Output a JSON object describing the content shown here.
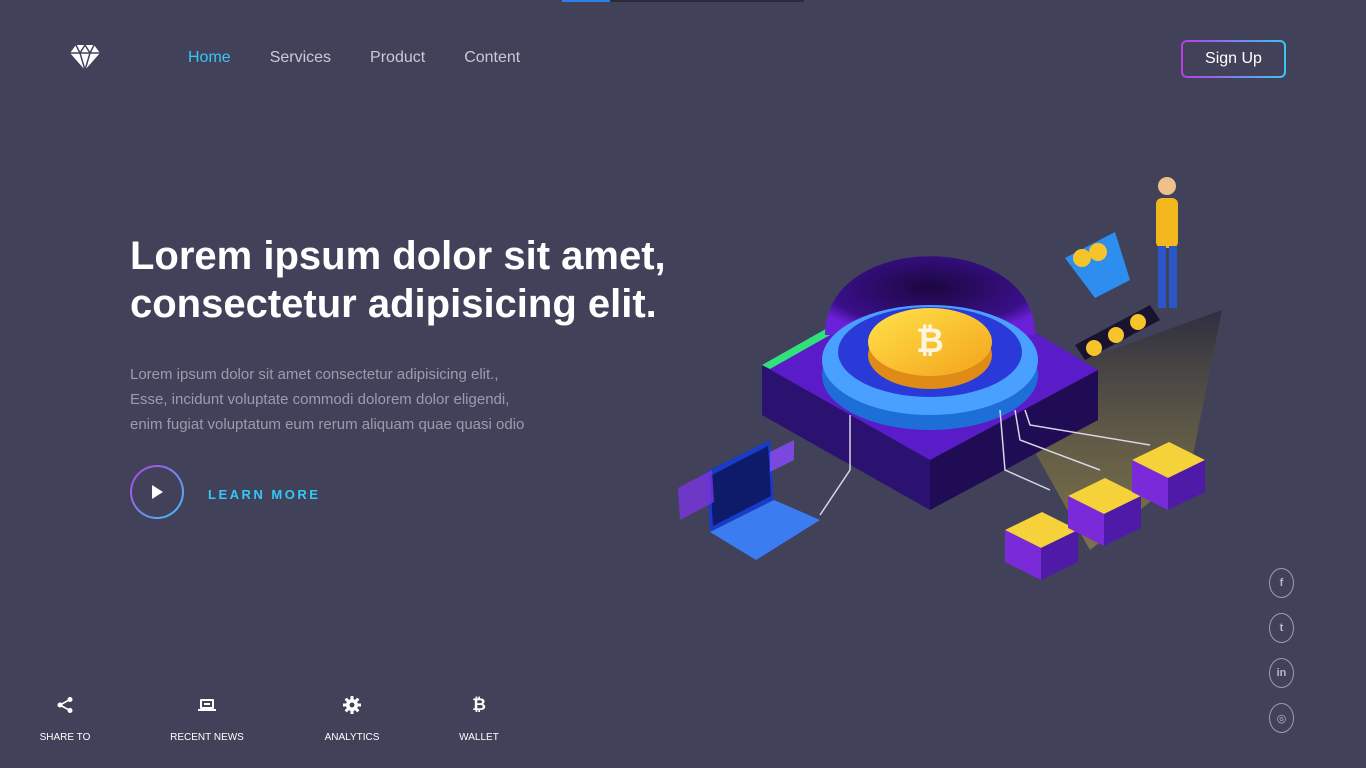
{
  "top_progress": {
    "fraction": 0.2
  },
  "brand": {
    "icon": "diamond-icon"
  },
  "nav": {
    "items": [
      {
        "label": "Home",
        "active": true
      },
      {
        "label": "Services",
        "active": false
      },
      {
        "label": "Product",
        "active": false
      },
      {
        "label": "Content",
        "active": false
      }
    ],
    "signup_label": "Sign Up"
  },
  "hero": {
    "title_line1": "Lorem ipsum dolor sit amet,",
    "title_line2": "consectetur adipisicing elit.",
    "desc_line1": "Lorem ipsum dolor sit amet consectetur adipisicing elit.,",
    "desc_line2": "Esse, incidunt voluptate commodi dolorem dolor eligendi,",
    "desc_line3": "enim fugiat voluptatum eum rerum aliquam quae quasi odio",
    "cta_label": "LEARN MORE"
  },
  "social": {
    "items": [
      {
        "icon": "facebook-icon",
        "glyph": "f"
      },
      {
        "icon": "twitter-icon",
        "glyph": "t"
      },
      {
        "icon": "linkedin-icon",
        "glyph": "in"
      },
      {
        "icon": "instagram-icon",
        "glyph": "◎"
      }
    ]
  },
  "bottom_nav": {
    "items": [
      {
        "label": "SHARE TO",
        "icon": "share-icon"
      },
      {
        "label": "RECENT NEWS",
        "icon": "laptop-icon"
      },
      {
        "label": "ANALYTICS",
        "icon": "gear-icon"
      },
      {
        "label": "WALLET",
        "icon": "bitcoin-icon",
        "glyph": "₿"
      }
    ]
  },
  "colors": {
    "background": "#41425a",
    "accent_cyan": "#35c7f5",
    "accent_purple": "#b93de6",
    "text_muted": "#9b9cab"
  }
}
